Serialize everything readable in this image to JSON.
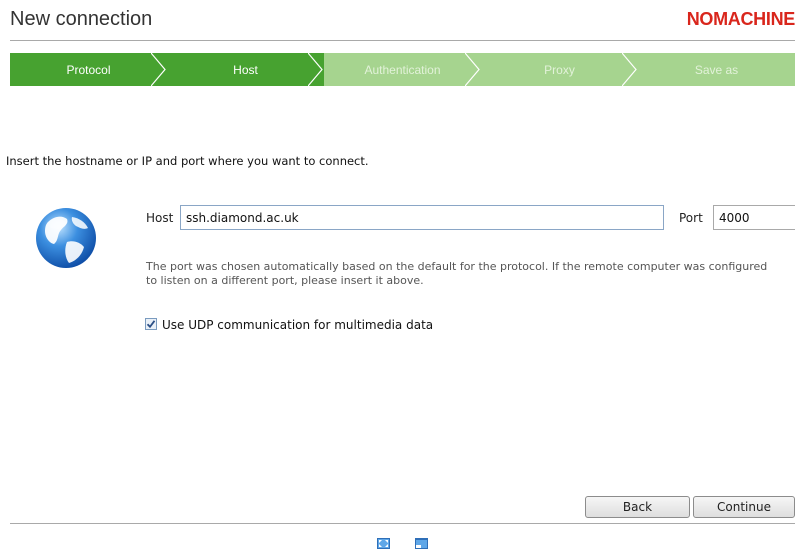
{
  "header": {
    "title": "New connection",
    "brand": "NOMACHINE"
  },
  "steps": [
    {
      "label": "Protocol",
      "state": "done"
    },
    {
      "label": "Host",
      "state": "current"
    },
    {
      "label": "Authentication",
      "state": "todo"
    },
    {
      "label": "Proxy",
      "state": "todo"
    },
    {
      "label": "Save as",
      "state": "todo"
    }
  ],
  "form": {
    "instruction": "Insert the hostname or IP and port where you want to connect.",
    "host_label": "Host",
    "host_value": "ssh.diamond.ac.uk",
    "port_label": "Port",
    "port_value": "4000",
    "hint": "The port was chosen automatically based on the default for the protocol. If the remote computer was configured to listen on a different port, please insert it above.",
    "udp_label": "Use UDP communication for multimedia data",
    "udp_checked": true
  },
  "buttons": {
    "back": "Back",
    "continue": "Continue"
  },
  "icons": {
    "globe": "globe-icon",
    "checkmark": "checkmark-icon",
    "footer_left": "fullscreen-icon",
    "footer_right": "window-icon"
  },
  "colors": {
    "step_done": "#47a230",
    "step_todo": "#a6d48f",
    "brand": "#d9261c"
  }
}
